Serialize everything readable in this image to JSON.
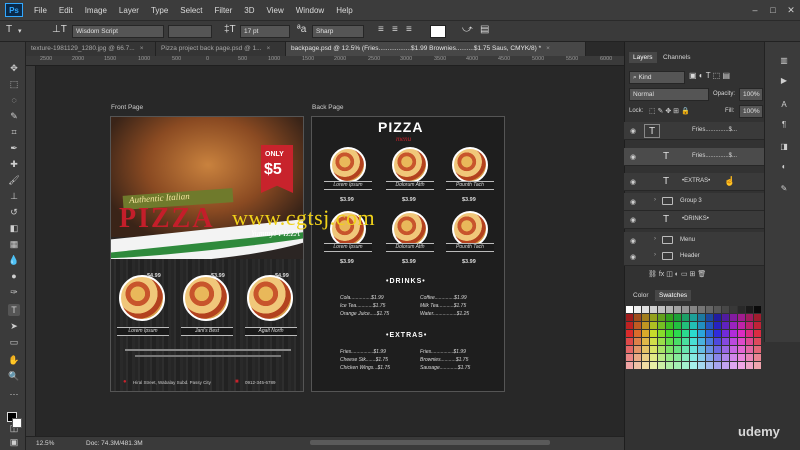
{
  "app": {
    "logo": "Ps"
  },
  "menubar": {
    "items": [
      "File",
      "Edit",
      "Image",
      "Layer",
      "Type",
      "Select",
      "Filter",
      "3D",
      "View",
      "Window",
      "Help"
    ]
  },
  "options": {
    "font": "Wisdom Script",
    "size": "17 pt",
    "antialias": "Sharp"
  },
  "tabs": [
    {
      "label": "texture-1981129_1280.jpg @ 66.7...",
      "close": "×"
    },
    {
      "label": "Pizza project back page.psd @ 1...",
      "close": "×"
    },
    {
      "label": "backpage.psd @ 12.5% (Fries..................$1.99 Brownies..........$1.75 Saus, CMYK/8) *",
      "close": "×"
    }
  ],
  "ruler": {
    "top": [
      "2500",
      "2000",
      "1500",
      "1000",
      "500",
      "0",
      "500",
      "1000",
      "1500",
      "2000",
      "2500",
      "3000",
      "3500",
      "4000",
      "4500",
      "5000",
      "5500",
      "6000"
    ]
  },
  "canvas": {
    "front_label": "Front Page",
    "back_label": "Back Page",
    "watermark": "www.cgtsj.com"
  },
  "front": {
    "only": "ONLY",
    "price": "$5",
    "banner": "Authentic Italian",
    "title": "PIZZA",
    "yummy": "Yummy! PIZZA",
    "prices": [
      "$4.99",
      "$3.99",
      "$4.99"
    ],
    "ribbons": [
      "Lorem Ipsum",
      "Jani's Best",
      "Agalt North"
    ],
    "address": "Hiral Street, Wabalay Subd. Passy City",
    "phone": "0912-345-6789"
  },
  "back": {
    "title": "PIZZA",
    "subtitle": "menu",
    "ribbons_row1": [
      "Lorem Ipsum",
      "Dolorum Atth",
      "Pounth Tach"
    ],
    "ribbons_row2": [
      "Lorem Ipsum",
      "Dolorum Atth",
      "Pounth Tach"
    ],
    "prices_row1": [
      "$3.99",
      "$3.99",
      "$3.99"
    ],
    "prices_row2": [
      "$3.99",
      "$3.99",
      "$3.99"
    ],
    "drinks_title": "•DRINKS•",
    "drinks_left": [
      "Cola...............$1.99",
      "Ice Tea............$1.75",
      "Orange Juice.....$1.75"
    ],
    "drinks_right": [
      "Coffee..............$1.99",
      "Milk Tea...........$1.75",
      "Water.................$1.25"
    ],
    "extras_title": "•EXTRAS•",
    "extras_left": [
      "Fries................$1.99",
      "Cheese Stk.......$1.75",
      "Chicken Wings...$1.75"
    ],
    "extras_right": [
      "Fries................$1.99",
      "Brownies...........$1.75",
      "Sausage.............$1.75"
    ]
  },
  "status": {
    "zoom": "12.5%",
    "doc": "Doc: 74.3M/481.3M"
  },
  "panels": {
    "tabs": [
      "Layers",
      "Channels"
    ],
    "kind": "Kind",
    "blend": "Normal",
    "opacity_label": "Opacity:",
    "opacity": "100%",
    "lock_label": "Lock:",
    "fill_label": "Fill:",
    "fill": "100%",
    "layers": [
      {
        "name": "Fries..............$...",
        "type": "text"
      },
      {
        "name": "Fries..............$...",
        "type": "text"
      },
      {
        "name": "•EXTRAS•",
        "type": "text"
      },
      {
        "name": "Group 3",
        "type": "folder"
      },
      {
        "name": "•DRINKS•",
        "type": "text"
      },
      {
        "name": "Menu",
        "type": "folder"
      },
      {
        "name": "Header",
        "type": "folder"
      }
    ],
    "color_tabs": [
      "Color",
      "Swatches"
    ]
  },
  "watermark_brand": "udemy"
}
